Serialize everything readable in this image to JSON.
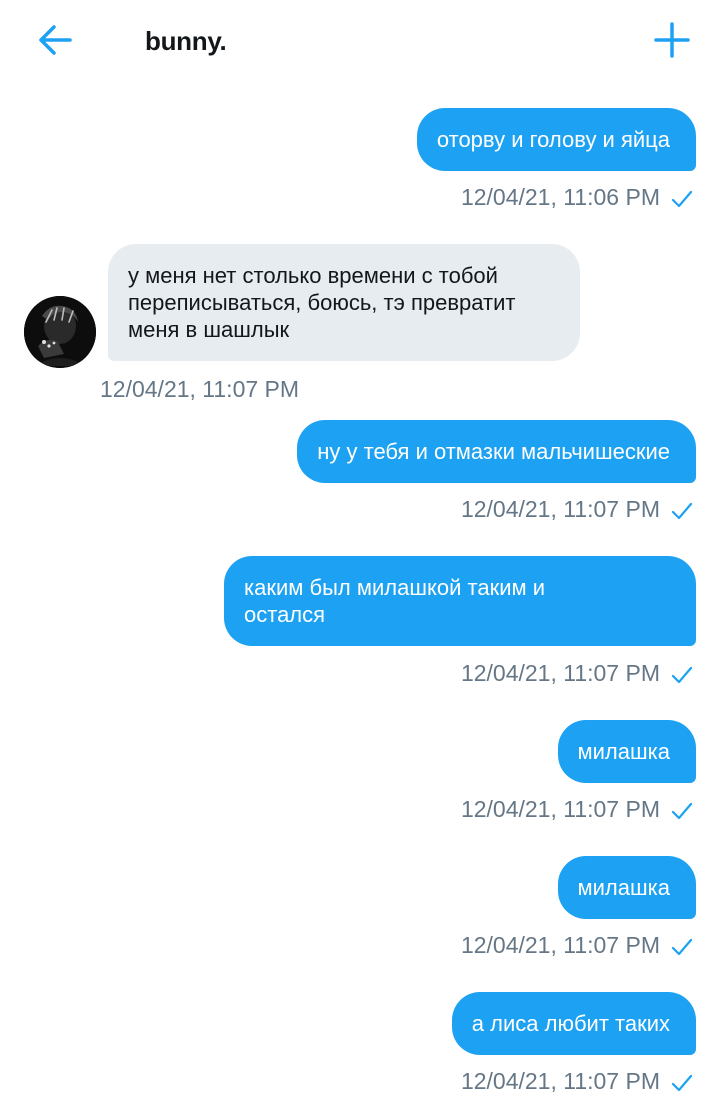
{
  "header": {
    "title": "bunny."
  },
  "messages": [
    {
      "direction": "out",
      "text": "оторву и голову и яйца",
      "time": "12/04/21, 11:06 PM",
      "read": true
    },
    {
      "direction": "in",
      "text": "у меня нет столько времени с тобой\nпереписываться, боюсь, тэ превратит\nменя в шашлык",
      "time": "12/04/21, 11:07 PM"
    },
    {
      "direction": "out",
      "text": "ну у тебя и отмазки мальчишеские",
      "time": "12/04/21, 11:07 PM",
      "read": true
    },
    {
      "direction": "out",
      "text": "каким был милашкой таким и\nостался",
      "time": "12/04/21, 11:07 PM",
      "read": true
    },
    {
      "direction": "out",
      "text": "милашка",
      "time": "12/04/21, 11:07 PM",
      "read": true
    },
    {
      "direction": "out",
      "text": "милашка",
      "time": "12/04/21, 11:07 PM",
      "read": true
    },
    {
      "direction": "out",
      "text": "а лиса любит таких",
      "time": "12/04/21, 11:07 PM",
      "read": true
    }
  ],
  "icons": {
    "back": "arrow-left-icon",
    "new": "plus-icon",
    "read": "checkmark-icon"
  },
  "colors": {
    "accent": "#1da1f2",
    "incoming_bubble": "#e6ecf0",
    "timestamp": "#657786"
  }
}
